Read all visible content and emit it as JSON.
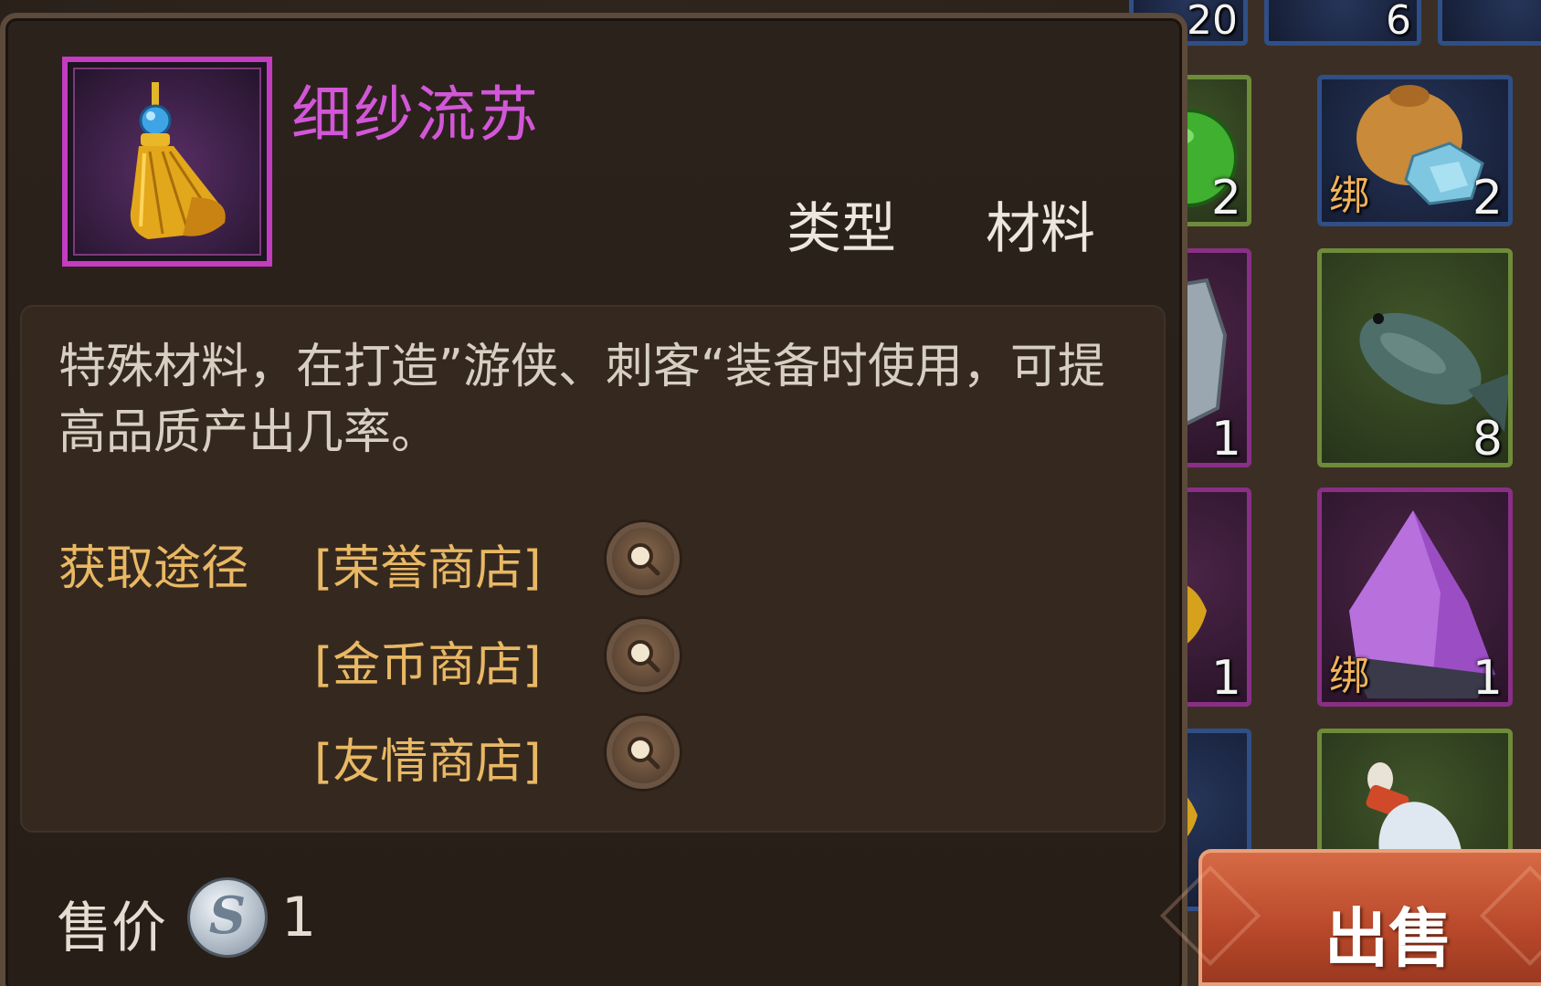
{
  "tooltip": {
    "item_name": "细纱流苏",
    "type_label": "类型",
    "type_value": "材料",
    "description": "特殊材料，在打造”游侠、刺客“装备时使用，可提高品质产出几率。",
    "source_label": "获取途径",
    "sources": [
      "[荣誉商店]",
      "[金币商店]",
      "[友情商店]"
    ],
    "price_label": "售价",
    "price_currency_icon": "silver-coin-icon",
    "price_value": "1",
    "item_icon": "tassel-icon",
    "rarity_color": "#c43cc0"
  },
  "sell_button": {
    "label": "出售"
  },
  "inventory": {
    "slots": [
      {
        "count": "20",
        "bound": "",
        "rarity": "blue",
        "icon": "item-icon"
      },
      {
        "count": "6",
        "bound": "",
        "rarity": "blue",
        "icon": "item-icon"
      },
      {
        "count": "",
        "bound": "",
        "rarity": "blue",
        "icon": "item-icon"
      },
      {
        "count": "2",
        "bound": "",
        "rarity": "green",
        "icon": "green-potion-icon"
      },
      {
        "count": "2",
        "bound": "绑",
        "rarity": "blue",
        "icon": "crystal-bag-icon"
      },
      {
        "count": "1",
        "bound": "",
        "rarity": "purple",
        "icon": "rune-stone-icon"
      },
      {
        "count": "8",
        "bound": "",
        "rarity": "green",
        "icon": "fish-icon"
      },
      {
        "count": "1",
        "bound": "",
        "rarity": "purple",
        "icon": "tassel-icon"
      },
      {
        "count": "1",
        "bound": "绑",
        "rarity": "purple",
        "icon": "purple-crystal-icon"
      },
      {
        "count": "",
        "bound": "",
        "rarity": "blue",
        "icon": "gold-item-icon"
      },
      {
        "count": "",
        "bound": "",
        "rarity": "green",
        "icon": "milk-bottle-icon"
      }
    ]
  }
}
